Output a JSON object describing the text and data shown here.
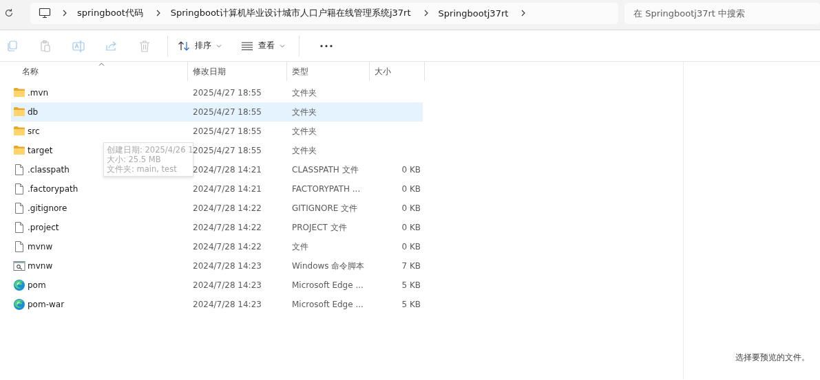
{
  "address_bar": {
    "crumbs": [
      "springboot代码",
      "Springboot计算机毕业设计城市人口户籍在线管理系统j37rt",
      "Springbootj37rt"
    ]
  },
  "search": {
    "placeholder": "在 Springbootj37rt 中搜索"
  },
  "toolbar": {
    "actions": [
      {
        "kind": "copy",
        "disabled": true
      },
      {
        "kind": "paste",
        "disabled": true
      },
      {
        "kind": "rename",
        "disabled": true
      },
      {
        "kind": "share",
        "disabled": true
      },
      {
        "kind": "delete",
        "disabled": true
      }
    ],
    "sort": "排序",
    "view": "查看"
  },
  "table": {
    "columns": [
      "名称",
      "修改日期",
      "类型",
      "大小"
    ],
    "rows": [
      {
        "kind": "folder",
        "name": ".mvn",
        "date": "2025/4/27 18:55",
        "type": "文件夹",
        "selected": false
      },
      {
        "kind": "folder",
        "name": "db",
        "date": "2025/4/27 18:55",
        "type": "文件夹",
        "selected": true
      },
      {
        "kind": "folder",
        "name": "src",
        "date": "2025/4/27 18:55",
        "type": "文件夹",
        "selected": false
      },
      {
        "kind": "folder",
        "name": "target",
        "date": "2025/4/27 18:55",
        "type": "文件夹",
        "selected": false
      },
      {
        "kind": "file",
        "name": ".classpath",
        "date": "2024/7/28 14:21",
        "type": "CLASSPATH 文件",
        "size": "0 KB",
        "selected": false
      },
      {
        "kind": "file",
        "name": ".factorypath",
        "date": "2024/7/28 14:21",
        "type": "FACTORYPATH ...",
        "size": "0 KB",
        "selected": false
      },
      {
        "kind": "file",
        "name": ".gitignore",
        "date": "2024/7/28 14:22",
        "type": "GITIGNORE 文件",
        "size": "0 KB",
        "selected": false
      },
      {
        "kind": "file",
        "name": ".project",
        "date": "2024/7/28 14:22",
        "type": "PROJECT 文件",
        "size": "0 KB",
        "selected": false
      },
      {
        "kind": "file",
        "name": "mvnw",
        "date": "2024/7/28 14:22",
        "type": "文件",
        "size": "0 KB",
        "selected": false
      },
      {
        "kind": "script",
        "name": "mvnw",
        "date": "2024/7/28 14:23",
        "type": "Windows 命令脚本",
        "size": "7 KB",
        "selected": false
      },
      {
        "kind": "edge",
        "name": "pom",
        "date": "2024/7/28 14:23",
        "type": "Microsoft Edge ...",
        "size": "5 KB",
        "selected": false
      },
      {
        "kind": "edge",
        "name": "pom-war",
        "date": "2024/7/28 14:23",
        "type": "Microsoft Edge ...",
        "size": "5 KB",
        "selected": false
      }
    ]
  },
  "tooltip": {
    "lines": [
      "创建日期: 2025/4/26 1",
      "大小: 25.5 MB",
      "文件夹: main, test"
    ]
  },
  "preview_pane": {
    "message": "选择要预览的文件。"
  }
}
